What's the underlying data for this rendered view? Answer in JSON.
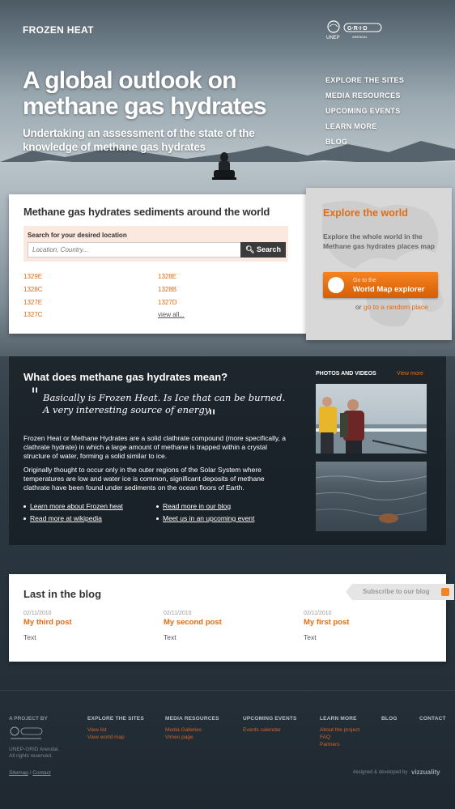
{
  "header": {
    "logo_text": "FROZEN HEAT",
    "partner_logo": "UNEP GRID Arendal"
  },
  "hero": {
    "title": "A global outlook on methane gas hydrates",
    "subtitle": "Undertaking an assessment of the state of the knowledge of methane gas hydrates"
  },
  "nav": {
    "items": [
      {
        "label": "EXPLORE THE SITES"
      },
      {
        "label": "MEDIA RESOURCES"
      },
      {
        "label": "UPCOMING EVENTS"
      },
      {
        "label": "LEARN MORE"
      },
      {
        "label": "BLOG"
      }
    ]
  },
  "search": {
    "heading": "Methane gas hydrates sediments around the world",
    "label": "Search for your desired location",
    "placeholder": "Location, Country...",
    "button": "Search",
    "locations": [
      "1329E",
      "1328C",
      "1327E",
      "1327C",
      "1328E",
      "1328B",
      "1327D"
    ],
    "view_all": "view all..."
  },
  "explore": {
    "heading": "Explore the world",
    "text": "Explore the whole world in the Methane gas hydrates places map",
    "button_small": "Go to the",
    "button_big": "World Map explorer",
    "or": "or",
    "random": "go to a random place"
  },
  "info": {
    "heading": "What does methane gas hydrates mean?",
    "quote_line1": "Basically is Frozen Heat. Is Ice that can be burned.",
    "quote_line2": "A very interesting source of energy",
    "paragraph1": "Frozen Heat or Methane Hydrates are a solid clathrate compound (more specifically, a clathrate hydrate) in which a large amount of methane is trapped within a crystal structure of water, forming a solid similar to ice.",
    "paragraph2": "Originally thought to occur only in the outer regions of the Solar System where temperatures are low and water ice is common, significant deposits of methane clathrate have been found under sediments on the ocean floors of Earth.",
    "links": [
      "Learn more about Frozen heat",
      "Read more at wikipedia",
      "Read more in our blog",
      "Meet us in an upcoming event"
    ],
    "photos_title": "PHOTOS AND VIDEOS",
    "view_more": "View more"
  },
  "blog": {
    "heading": "Last in the blog",
    "subscribe": "Subscribe to our blog",
    "posts": [
      {
        "date": "02/11/2010",
        "title": "My third post",
        "text": "Text"
      },
      {
        "date": "02/11/2010",
        "title": "My second post",
        "text": "Text"
      },
      {
        "date": "02/11/2010",
        "title": "My first post",
        "text": "Text"
      }
    ]
  },
  "footer": {
    "project_label": "A PROJECT BY",
    "org_note_1": "UNEP-GRID Arendal.",
    "org_note_2": "All rights reserved.",
    "sitemap": "Sitemap",
    "separator": "/",
    "contact": "Contact",
    "credit": "designed & developed by",
    "credit_brand": "vizzuality",
    "columns": [
      {
        "head": "EXPLORE THE SITES",
        "links": [
          "View list",
          "View world map"
        ]
      },
      {
        "head": "MEDIA RESOURCES",
        "links": [
          "Media Galleries",
          "Vimeo page"
        ]
      },
      {
        "head": "UPCOMING EVENTS",
        "links": [
          "Events calendar"
        ]
      },
      {
        "head": "LEARN MORE",
        "links": [
          "About the project",
          "FAQ",
          "Partners"
        ]
      },
      {
        "head": "BLOG",
        "links": []
      },
      {
        "head": "CONTACT",
        "links": []
      }
    ]
  },
  "colors": {
    "accent": "#e36b12",
    "dark_panel": "#1f2a33"
  }
}
